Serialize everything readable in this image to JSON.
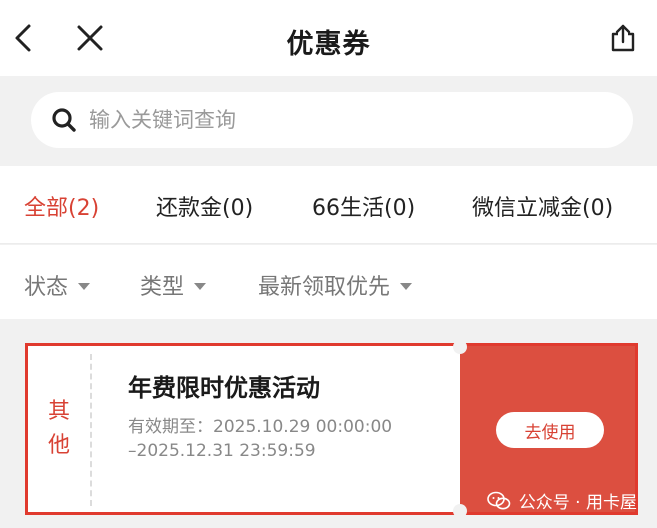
{
  "header": {
    "title": "优惠券"
  },
  "search": {
    "placeholder": "输入关键词查询"
  },
  "tabs": [
    {
      "label": "全部(2)",
      "active": true
    },
    {
      "label": "还款金(0)",
      "active": false
    },
    {
      "label": "66生活(0)",
      "active": false
    },
    {
      "label": "微信立减金(0)",
      "active": false
    }
  ],
  "filters": [
    {
      "label": "状态"
    },
    {
      "label": "类型"
    },
    {
      "label": "最新领取优先"
    }
  ],
  "coupons": [
    {
      "category_line1": "其",
      "category_line2": "他",
      "name": "年费限时优惠活动",
      "validity_line1": "有效期至：2025.10.29 00:00:00",
      "validity_line2": "–2025.12.31 23:59:59",
      "action_label": "去使用"
    }
  ],
  "watermark": {
    "text": "公众号 · 用卡屋"
  },
  "colors": {
    "accent": "#d84234",
    "coupon_right": "#dc4f40",
    "coupon_border": "#e03a2e",
    "background": "#f1f1f1"
  },
  "icons": {
    "back": "chevron-left-icon",
    "close": "close-icon",
    "share": "share-icon",
    "search": "search-icon",
    "watermark": "wechat-icon"
  }
}
